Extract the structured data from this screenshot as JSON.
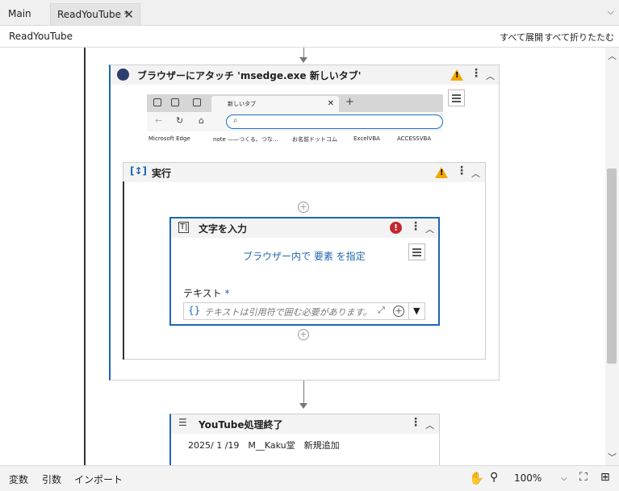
{
  "tabs": [
    {
      "label": "Main"
    },
    {
      "label": "ReadYouTube *"
    }
  ],
  "breadcrumb": "ReadYouTube",
  "toolbar": {
    "expand_all": "すべて展開",
    "collapse_all": "すべて折りたたむ"
  },
  "attach_browser": {
    "title": "ブラウザーにアタッチ 'msedge.exe 新しいタブ'",
    "preview": {
      "tab_title": "新しいタブ",
      "bookmarks": [
        "Microsoft Edge",
        "note ——つくる、つな...",
        "お名前ドットコム",
        "ExcelVBA",
        "ACCESSVBA"
      ]
    }
  },
  "execute": {
    "title": "実行"
  },
  "type_into": {
    "title": "文字を入力",
    "indicate_link": "ブラウザー内で 要素 を指定",
    "text_label": "テキスト",
    "required_mark": "*",
    "text_placeholder": "テキストは引用符で囲む必要があります。"
  },
  "end_activity": {
    "title": "YouTube処理終了",
    "note": "2025/ 1 /19　M__Kaku堂　新規追加"
  },
  "statusbar": {
    "variables": "変数",
    "arguments": "引数",
    "imports": "インポート",
    "zoom": "100%"
  },
  "colors": {
    "accent": "#1f67b1",
    "warning": "#f0a800",
    "error": "#c4262e"
  }
}
